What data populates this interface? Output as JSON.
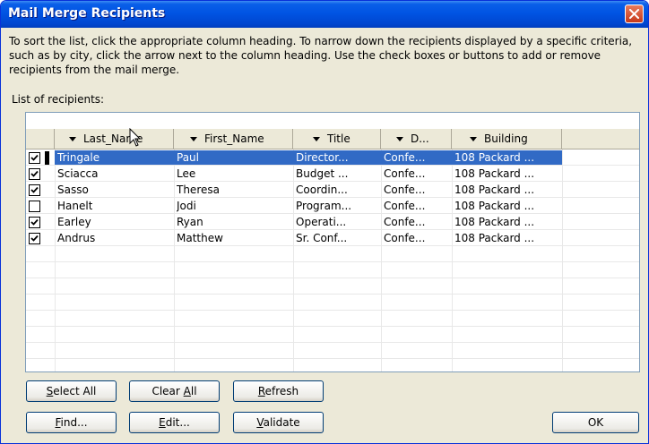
{
  "window": {
    "title": "Mail Merge Recipients"
  },
  "description": "To sort the list, click the appropriate column heading.  To narrow down the recipients displayed by a specific criteria, such as by city, click the arrow next to the column heading.  Use the check boxes or buttons to add or remove recipients from the mail merge.",
  "list_label": "List of recipients:",
  "columns": [
    {
      "label": "Last_Name"
    },
    {
      "label": "First_Name"
    },
    {
      "label": "Title"
    },
    {
      "label": "D..."
    },
    {
      "label": "Building"
    }
  ],
  "rows": [
    {
      "checked": true,
      "selected": true,
      "last": "Tringale",
      "first": "Paul",
      "title": "Director...",
      "dept": "Confe...",
      "building": "108 Packard ..."
    },
    {
      "checked": true,
      "selected": false,
      "last": "Sciacca",
      "first": "Lee",
      "title": "Budget ...",
      "dept": "Confe...",
      "building": "108 Packard ..."
    },
    {
      "checked": true,
      "selected": false,
      "last": "Sasso",
      "first": "Theresa",
      "title": "Coordin...",
      "dept": "Confe...",
      "building": "108 Packard ..."
    },
    {
      "checked": false,
      "selected": false,
      "last": "Hanelt",
      "first": "Jodi",
      "title": "Program...",
      "dept": "Confe...",
      "building": "108 Packard ..."
    },
    {
      "checked": true,
      "selected": false,
      "last": "Earley",
      "first": "Ryan",
      "title": "Operati...",
      "dept": "Confe...",
      "building": "108 Packard ..."
    },
    {
      "checked": true,
      "selected": false,
      "last": "Andrus",
      "first": "Matthew",
      "title": "Sr. Conf...",
      "dept": "Confe...",
      "building": "108 Packard ..."
    }
  ],
  "buttons": {
    "select_all": {
      "pre": "",
      "ul": "S",
      "post": "elect All"
    },
    "clear_all": {
      "pre": "Clear ",
      "ul": "A",
      "post": "ll"
    },
    "refresh": {
      "pre": "",
      "ul": "R",
      "post": "efresh"
    },
    "find": {
      "pre": "",
      "ul": "F",
      "post": "ind..."
    },
    "edit": {
      "pre": "",
      "ul": "E",
      "post": "dit..."
    },
    "validate": {
      "pre": "",
      "ul": "V",
      "post": "alidate"
    },
    "ok": "OK"
  },
  "colors": {
    "titlebar": "#0054E3",
    "selection": "#316AC5",
    "dialog_bg": "#ECE9D8"
  },
  "icons": {
    "close": "close-icon",
    "checkbox": "checkbox-check-icon",
    "dropdown": "dropdown-arrow-icon",
    "cursor": "mouse-cursor-icon"
  }
}
